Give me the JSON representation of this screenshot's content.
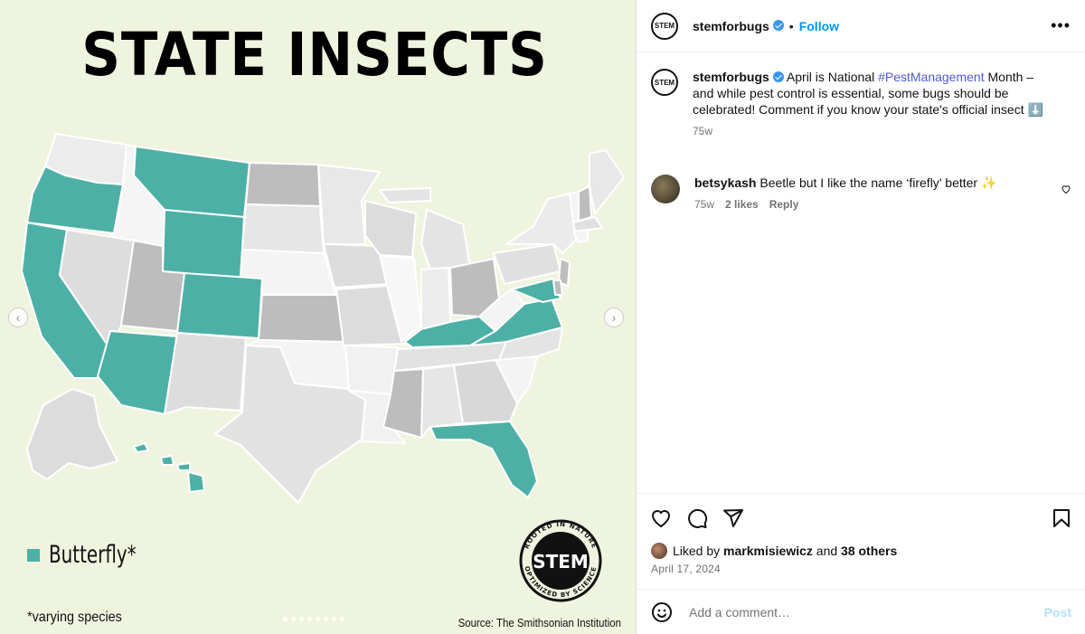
{
  "image": {
    "title": "STATE INSECTS",
    "legend_label": "Butterfly*",
    "footnote": "*varying species",
    "source": "Source: The Smithsonian Institution",
    "logo_text": "STEM",
    "logo_ring_top": "ROOTED IN NATURE",
    "logo_ring_bottom": "OPTIMIZED BY SCIENCE",
    "colors": {
      "highlight": "#4db0a6",
      "background": "#eff4df"
    },
    "prev_icon": "chevron-left-icon",
    "next_icon": "chevron-right-icon",
    "carousel_dots": 8
  },
  "header": {
    "avatar_text": "STEM",
    "username": "stemforbugs",
    "separator": "•",
    "follow_label": "Follow",
    "more_icon": "•••"
  },
  "caption": {
    "avatar_text": "STEM",
    "username": "stemforbugs",
    "text_before": " April is National ",
    "hashtag": "#PestManagement",
    "text_after": " Month – and while pest control is essential, some bugs should be celebrated! Comment if you know your state's official insect ⬇️",
    "time": "75w"
  },
  "comment": {
    "username": "betsykash",
    "text": " Beetle but I like the name ‘firefly’ better ✨",
    "time": "75w",
    "likes": "2 likes",
    "reply": "Reply"
  },
  "actions": {
    "liked_by_prefix": "Liked by ",
    "liked_by_user": "markmisiewicz",
    "and": " and ",
    "others": "38 others",
    "date": "April 17, 2024"
  },
  "comment_box": {
    "placeholder": "Add a comment…",
    "post_label": "Post"
  }
}
